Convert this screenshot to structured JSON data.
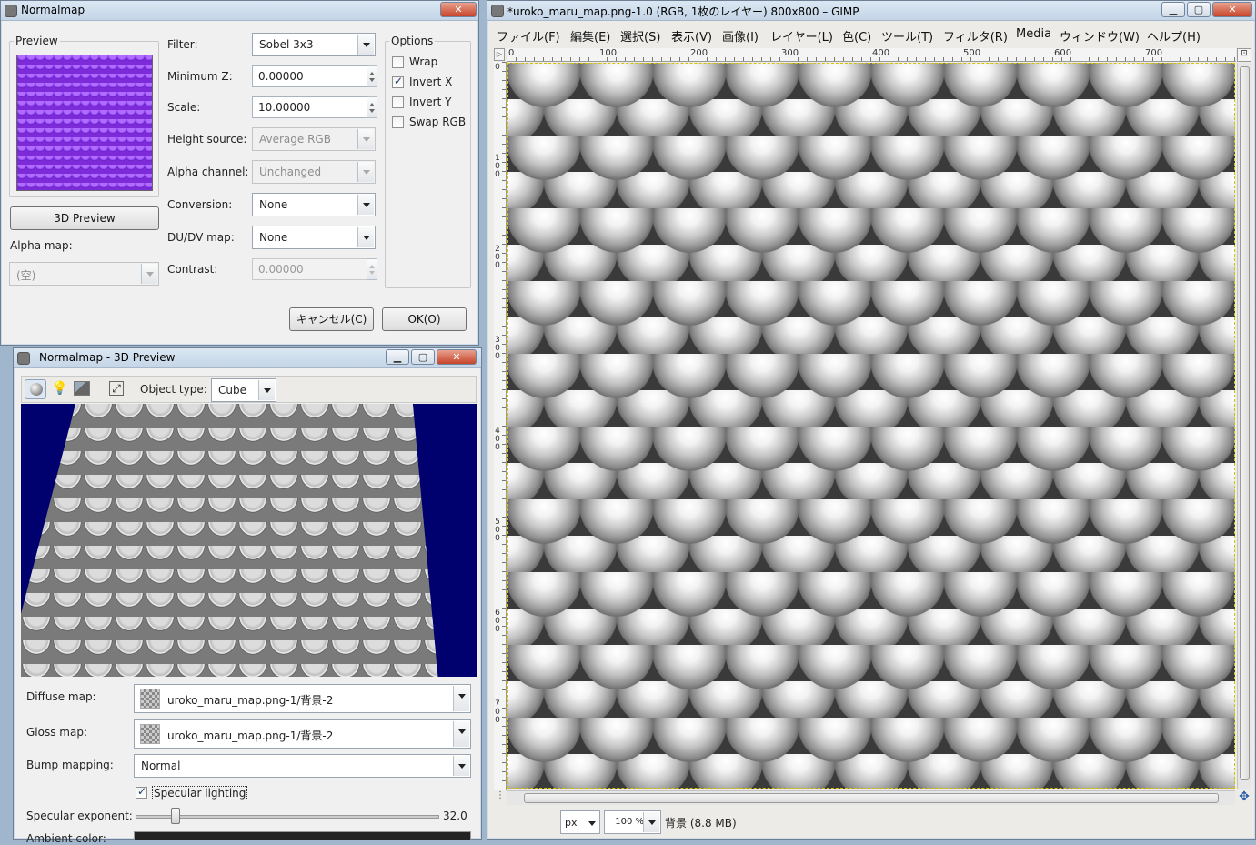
{
  "normalmap": {
    "title": "Normalmap",
    "preview_label": "Preview",
    "btn_3d_preview": "3D Preview",
    "alpha_map_label": "Alpha map:",
    "alpha_map_value": "(空)",
    "fields": {
      "filter_label": "Filter:",
      "filter_value": "Sobel 3x3",
      "minz_label": "Minimum Z:",
      "minz_value": "0.00000",
      "scale_label": "Scale:",
      "scale_value": "10.00000",
      "height_label": "Height source:",
      "height_value": "Average RGB",
      "alpha_label": "Alpha channel:",
      "alpha_value": "Unchanged",
      "conv_label": "Conversion:",
      "conv_value": "None",
      "dudv_label": "DU/DV map:",
      "dudv_value": "None",
      "contrast_label": "Contrast:",
      "contrast_value": "0.00000"
    },
    "options": {
      "label": "Options",
      "wrap": "Wrap",
      "invert_x": "Invert X",
      "invert_y": "Invert Y",
      "swap_rgb": "Swap RGB"
    },
    "cancel": "キャンセル(C)",
    "ok": "OK(O)"
  },
  "preview3d": {
    "title": "Normalmap - 3D Preview",
    "object_type_label": "Object type:",
    "object_type_value": "Cube",
    "diffuse_label": "Diffuse map:",
    "diffuse_value": "uroko_maru_map.png-1/背景-2",
    "gloss_label": "Gloss map:",
    "gloss_value": "uroko_maru_map.png-1/背景-2",
    "bump_label": "Bump mapping:",
    "bump_value": "Normal",
    "specular_lighting": "Specular lighting",
    "specular_exp_label": "Specular exponent:",
    "specular_exp_value": "32.0",
    "ambient_label": "Ambient color:"
  },
  "gimp": {
    "title": "*uroko_maru_map.png-1.0 (RGB, 1枚のレイヤー) 800x800 – GIMP",
    "menu": [
      "ファイル(F)",
      "編集(E)",
      "選択(S)",
      "表示(V)",
      "画像(I)",
      "レイヤー(L)",
      "色(C)",
      "ツール(T)",
      "フィルタ(R)",
      "Media",
      "ウィンドウ(W)",
      "ヘルプ(H)"
    ],
    "ruler_h": [
      "0",
      "100",
      "200",
      "300",
      "400",
      "500",
      "600",
      "700"
    ],
    "ruler_v": [
      "0",
      "100",
      "200",
      "300",
      "400",
      "500",
      "600",
      "700"
    ],
    "unit": "px",
    "zoom": "100 %",
    "status": "背景 (8.8 MB)"
  },
  "colors": {
    "preview3d_bg": "#00006e",
    "normalmap_preview": "#7d2bd8",
    "window_frame": "#c4d5e7"
  },
  "icons": {
    "sphere": "sphere-icon",
    "light": "light-icon",
    "image": "image-icon",
    "fullscreen": "fullscreen-icon"
  }
}
